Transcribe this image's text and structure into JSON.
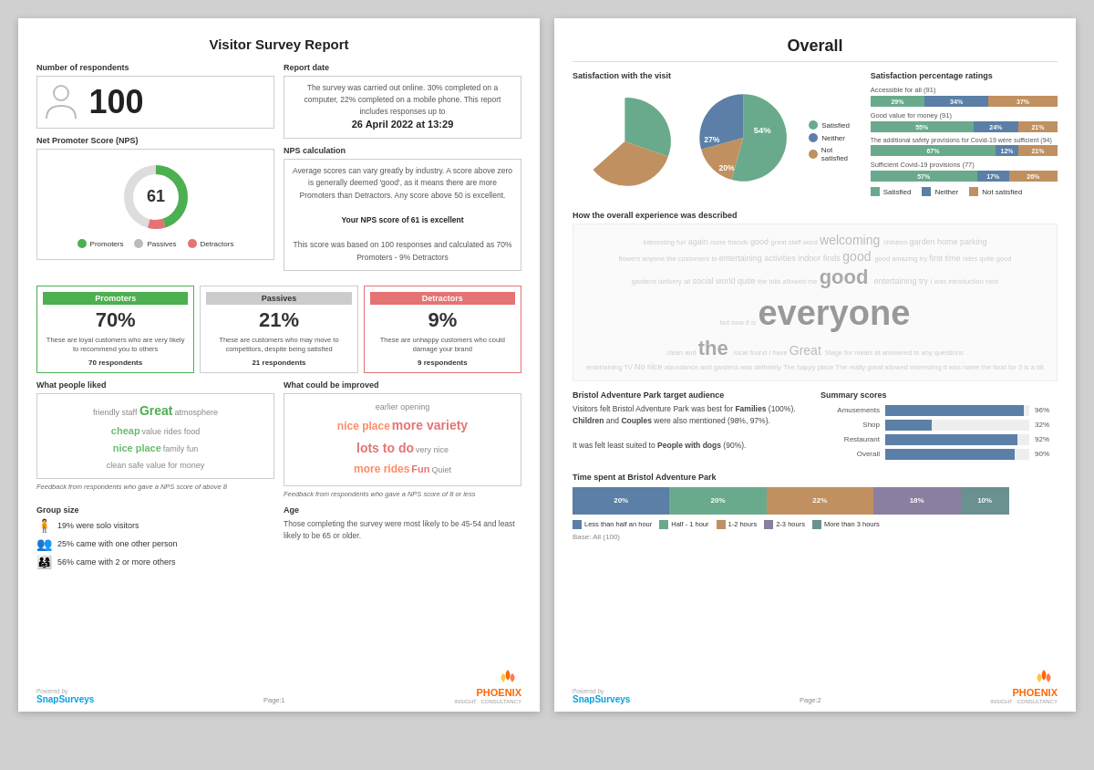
{
  "page1": {
    "title": "Visitor Survey Report",
    "respondents": {
      "label": "Number of respondents",
      "count": "100"
    },
    "report_date": {
      "label": "Report date",
      "body": "The survey was carried out online. 30% completed on a computer, 22% completed on a mobile phone. This report includes responses up to",
      "date": "26 April 2022 at 13:29"
    },
    "nps": {
      "label": "Net Promoter Score (NPS)",
      "score": "61",
      "calc_label": "NPS calculation",
      "calc_body": "Average scores can vary greatly by industry. A score above zero is generally deemed 'good', as it means there are more Promoters than Detractors. Any score above 50 is excellent.",
      "your_score": "Your NPS score of 61 is excellent",
      "based_on": "This score was based on 100 responses and calculated as 70% Promoters - 9% Detractors"
    },
    "legend": {
      "promoters": "Promoters",
      "passives": "Passives",
      "detractors": "Detractors"
    },
    "promo_cards": [
      {
        "header": "Promoters",
        "pct": "70%",
        "desc": "These are loyal customers who are very likely to recommend you to others",
        "resp": "70 respondents",
        "type": "promoters"
      },
      {
        "header": "Passives",
        "pct": "21%",
        "desc": "These are customers who may move to competitors, despite being satisfied",
        "resp": "21 respondents",
        "type": "passives"
      },
      {
        "header": "Detractors",
        "pct": "9%",
        "desc": "These are unhappy customers who could damage your brand",
        "resp": "9 respondents",
        "type": "detractors"
      }
    ],
    "liked": {
      "label": "What people liked",
      "caption": "Feedback from respondents who gave a NPS score of above 8"
    },
    "improved": {
      "label": "What could be improved",
      "caption": "Feedback from respondents who gave a NPS score of 8 or less"
    },
    "group_size": {
      "label": "Group size",
      "items": [
        {
          "icon": "👤",
          "text": "19% were solo visitors"
        },
        {
          "icon": "👥",
          "text": "25% came with one other person"
        },
        {
          "icon": "👨‍👩‍👧‍👦",
          "text": "56% came with 2 or more others"
        }
      ]
    },
    "age": {
      "label": "Age",
      "text": "Those completing the survey were most likely to be 45-54 and least likely to be 65 or older."
    },
    "footer": {
      "powered_by": "Powered by",
      "snap": "SnapSurveys",
      "page": "Page:1",
      "phoenix": "PHOENIX",
      "phoenix_sub": "INSIGHT · CONSULTANCY"
    }
  },
  "page2": {
    "title": "Overall",
    "satisfaction_visit": {
      "label": "Satisfaction with the visit",
      "legend": {
        "satisfied": "Satisfied",
        "neither": "Neither",
        "not_satisfied": "Not satisfied"
      },
      "pie": {
        "satisfied_pct": 54,
        "neither_pct": 20,
        "not_satisfied_pct": 27
      }
    },
    "satisfaction_pct": {
      "label": "Satisfaction percentage ratings",
      "bars": [
        {
          "label": "Accessible for all (91)",
          "satisfied": 29,
          "neither": 34,
          "not_satisfied": 37
        },
        {
          "label": "Good value for money (91)",
          "satisfied": 55,
          "neither": 24,
          "not_satisfied": 21
        },
        {
          "label": "The additional safety provisions for Covid-19 were sufficient (94)",
          "satisfied": 67,
          "neither": 12,
          "not_satisfied": 21
        },
        {
          "label": "Sufficient Covid-19 provisions (77)",
          "satisfied": 57,
          "neither": 17,
          "not_satisfied": 26
        }
      ],
      "legend": {
        "satisfied": "Satisfied",
        "neither": "Neither",
        "not_satisfied": "Not satisfied"
      }
    },
    "experience": {
      "label": "How the overall experience was described"
    },
    "audience": {
      "label": "Bristol Adventure Park target audience",
      "text1": "Visitors felt Bristol Adventure Park was best for",
      "bold1": "Families",
      "text2": "(100%).",
      "bold2": "Children",
      "text3": "and",
      "bold3": "Couples",
      "text4": "were also mentioned (98%, 97%).",
      "text5": "It was felt least suited to",
      "bold5": "People with dogs",
      "text6": "(90%)."
    },
    "summary": {
      "label": "Summary scores",
      "bars": [
        {
          "label": "Amusements",
          "pct": 96,
          "color": "#5b7fa6"
        },
        {
          "label": "Shop",
          "pct": 32,
          "color": "#5b7fa6"
        },
        {
          "label": "Restaurant",
          "pct": 92,
          "color": "#5b7fa6"
        },
        {
          "label": "Overall",
          "pct": 90,
          "color": "#5b7fa6"
        }
      ]
    },
    "time_spent": {
      "label": "Time spent at Bristol Adventure Park",
      "segments": [
        {
          "label": "20%",
          "pct": 20,
          "color": "#5b7fa6"
        },
        {
          "label": "20%",
          "pct": 20,
          "color": "#6aaa8c"
        },
        {
          "label": "22%",
          "pct": 22,
          "color": "#c09060"
        },
        {
          "label": "18%",
          "pct": 18,
          "color": "#8a7fa0"
        },
        {
          "label": "10%",
          "pct": 10,
          "color": "#6a9090"
        }
      ],
      "legend": [
        {
          "label": "Less than half an hour",
          "color": "#5b7fa6"
        },
        {
          "label": "Half - 1 hour",
          "color": "#6aaa8c"
        },
        {
          "label": "1-2 hours",
          "color": "#c09060"
        },
        {
          "label": "2-3 hours",
          "color": "#8a7fa0"
        },
        {
          "label": "More than 3 hours",
          "color": "#6a9090"
        }
      ],
      "base": "Base: All (100)"
    },
    "footer": {
      "powered_by": "Powered by",
      "snap": "SnapSurveys",
      "page": "Page:2",
      "phoenix": "PHOENIX",
      "phoenix_sub": "INSIGHT · CONSULTANCY"
    }
  }
}
